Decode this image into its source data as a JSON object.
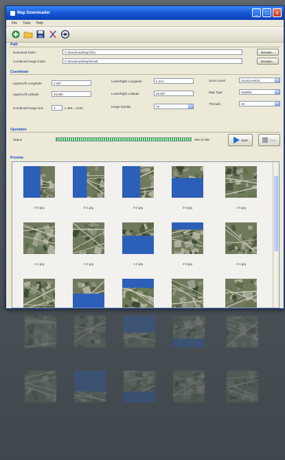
{
  "window": {
    "title": "Map Downloader",
    "controls": [
      "_",
      "□",
      "x"
    ]
  },
  "menu": [
    "File",
    "Tools",
    "Help"
  ],
  "toolbar": {
    "icons": [
      "new-icon",
      "open-folder-icon",
      "save-icon",
      "cut-icon",
      "settings-icon"
    ]
  },
  "path": {
    "section": "Path",
    "download_folder_label": "Download folder",
    "download_folder_value": "C:\\Download\\MapTiles",
    "combined_folder_label": "Combined image folder",
    "combined_folder_value": "C:\\Download\\MapResult",
    "browse_label": "Browse..."
  },
  "coordinate": {
    "section": "Coordinate",
    "ul_lon_label": "UpperLeft Longitude",
    "ul_lon_value": "2.287",
    "ul_lat_label": "UpperLeft Latitude",
    "ul_lat_value": "48.880",
    "lr_lon_label": "LowerRight Longitude",
    "lr_lon_value": "2.314",
    "lr_lat_label": "LowerRight Latitude",
    "lr_lat_value": "48.867",
    "combined_size_label": "Combined image size",
    "size_w": "4",
    "size_mid": "x 256 = 1024",
    "quality_label": "Image Quality",
    "quality_value": "70",
    "zoom_label": "Zoom Level",
    "zoom_value": "ZoomLevel16",
    "maptype_label": "Map Type",
    "maptype_value": "Satellite",
    "threads_label": "Threads",
    "threads_value": "10"
  },
  "operation": {
    "section": "Operation",
    "status_label": "Status",
    "progress": 1.0,
    "progress_text": "256 of 256",
    "start_label": "Start",
    "stop_label": "Stop"
  },
  "preview": {
    "section": "Preview",
    "tiles": [
      {
        "caption": "0-0.jpg",
        "blue": "left"
      },
      {
        "caption": "0-1.jpg",
        "blue": "left"
      },
      {
        "caption": "0-2.jpg",
        "blue": "left"
      },
      {
        "caption": "0-3.jpg",
        "blue": "bottom"
      },
      {
        "caption": "1-0.jpg",
        "blue": "none"
      },
      {
        "caption": "1-1.jpg",
        "blue": "none"
      },
      {
        "caption": "1-2.jpg",
        "blue": "none"
      },
      {
        "caption": "1-3.jpg",
        "blue": "bottom"
      },
      {
        "caption": "2-0.jpg",
        "blue": "top"
      },
      {
        "caption": "2-1.jpg",
        "blue": "none"
      },
      {
        "caption": "",
        "blue": "none"
      },
      {
        "caption": "",
        "blue": "bottom"
      },
      {
        "caption": "",
        "blue": "top"
      },
      {
        "caption": "",
        "blue": "none"
      },
      {
        "caption": "",
        "blue": "none"
      }
    ]
  },
  "colors": {
    "water": "#2b5fb8",
    "accent": "#1457d6",
    "progress": "#2fb74a"
  }
}
